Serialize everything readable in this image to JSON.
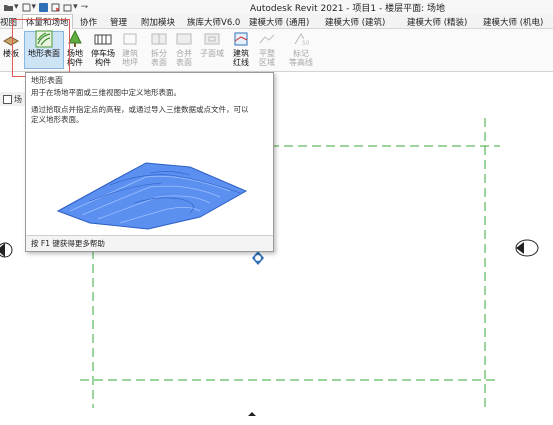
{
  "app": {
    "window_title": "Autodesk Revit 2021 - 项目1 - 楼层平面: 场地"
  },
  "tabs": [
    {
      "label": "视图"
    },
    {
      "label": "体量和场地",
      "active": true
    },
    {
      "label": "协作"
    },
    {
      "label": "管理"
    },
    {
      "label": "附加模块"
    },
    {
      "label": "族库大师V6.0"
    },
    {
      "label": "建模大师 (通用)"
    },
    {
      "label": "建模大师 (建筑)"
    },
    {
      "label": "建模大师 (精装)"
    },
    {
      "label": "建模大师 (机电)"
    }
  ],
  "ribbon": {
    "buttons": [
      {
        "line1": "楼板",
        "line2": ""
      },
      {
        "line1": "地形表面",
        "line2": ""
      },
      {
        "line1": "场地",
        "line2": "构件"
      },
      {
        "line1": "停车场",
        "line2": "构件"
      },
      {
        "line1": "建筑",
        "line2": "地坪"
      },
      {
        "line1": "拆分",
        "line2": "表面"
      },
      {
        "line1": "合并",
        "line2": "表面"
      },
      {
        "line1": "子面域",
        "line2": ""
      },
      {
        "line1": "建筑",
        "line2": "红线"
      },
      {
        "line1": "平整",
        "line2": "区域"
      },
      {
        "line1": "标记",
        "line2": "等高线"
      }
    ]
  },
  "view_tab": {
    "label": "场"
  },
  "tooltip": {
    "title": "地形表面",
    "description": "用于在场地平面或三维视图中定义地形表面。",
    "detail_line1": "通过拾取点并指定点的高程，或通过导入三维数据或点文件，可以",
    "detail_line2": "定义地形表面。",
    "footer": "按 F1 键获得更多帮助"
  },
  "colors": {
    "accent": "#2f6fb8",
    "selection_frame": "#e05a5a",
    "grid_line": "#3aa83a",
    "terrain": "#4a86e8"
  }
}
